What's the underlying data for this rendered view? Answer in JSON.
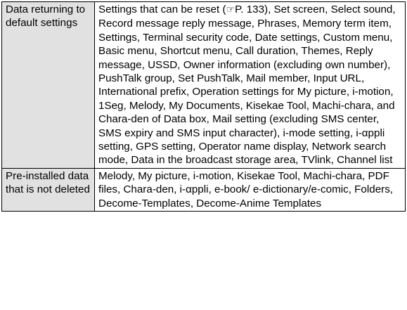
{
  "rows": [
    {
      "label": "Data returning to default settings",
      "content_before_ref": "Settings that can be reset (",
      "ref_icon": "page-reference-icon",
      "ref_text": "P. 133",
      "content_after_ref": "), Set screen, Select sound, Record message reply message, Phrases, Memory term item, Settings, Terminal security code, Date settings, Custom menu, Basic menu, Shortcut menu, Call duration, Themes, Reply message, USSD, Owner information (excluding own number), PushTalk group, Set PushTalk, Mail member, Input URL, International prefix, Operation settings for My picture, i-motion, 1Seg, Melody, My Documents, Kisekae Tool, Machi-chara, and Chara-den of Data box, Mail setting (excluding SMS center, SMS expiry and SMS input character), i-mode setting, i-αppli setting, GPS setting, Operator name display, Network search mode, Data in the broadcast storage area, TVlink, Channel list"
    },
    {
      "label": "Pre-installed data that is not deleted",
      "content": "Melody, My picture, i-motion, Kisekae Tool, Machi-chara, PDF files, Chara-den, i-αppli, e-book/ e-dictionary/e-comic, Folders, Decome-Templates, Decome-Anime Templates"
    }
  ]
}
